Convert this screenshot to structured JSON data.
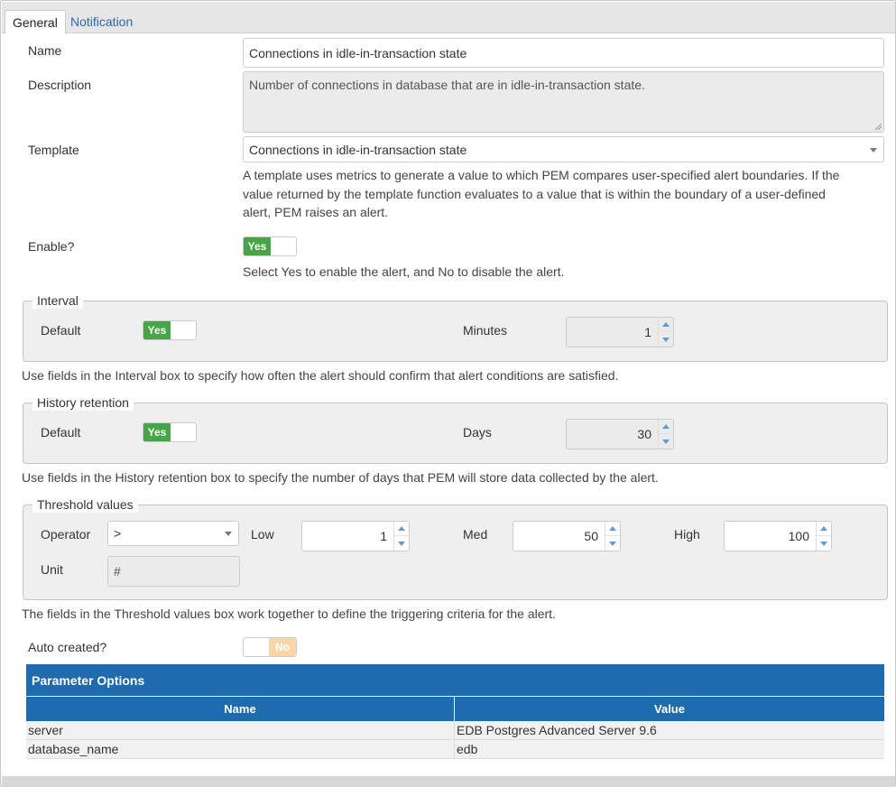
{
  "tabs": {
    "general": "General",
    "notification": "Notification"
  },
  "form": {
    "name": {
      "label": "Name",
      "value": "Connections in idle-in-transaction state"
    },
    "description": {
      "label": "Description",
      "value": "Number of connections in database that are in idle-in-transaction state."
    },
    "template": {
      "label": "Template",
      "value": "Connections in idle-in-transaction state",
      "help_lines": [
        "A template uses metrics to generate a value to which PEM compares user-specified alert boundaries. If the",
        "value returned by the template function evaluates to a value that is within the boundary of a user-defined",
        "alert, PEM raises an alert."
      ]
    },
    "enable": {
      "label": "Enable?",
      "toggle": "Yes",
      "help": "Select Yes to enable the alert, and No to disable the alert."
    }
  },
  "interval": {
    "legend": "Interval",
    "default_label": "Default",
    "default_toggle": "Yes",
    "minutes_label": "Minutes",
    "minutes_value": "1",
    "help": "Use fields in the Interval box to specify how often the alert should confirm that alert conditions are satisfied."
  },
  "history": {
    "legend": "History retention",
    "default_label": "Default",
    "default_toggle": "Yes",
    "days_label": "Days",
    "days_value": "30",
    "help": "Use fields in the History retention box to specify the number of days that PEM will store data collected by the alert."
  },
  "threshold": {
    "legend": "Threshold values",
    "operator_label": "Operator",
    "operator_value": ">",
    "low_label": "Low",
    "low_value": "1",
    "med_label": "Med",
    "med_value": "50",
    "high_label": "High",
    "high_value": "100",
    "unit_label": "Unit",
    "unit_value": "#",
    "help": "The fields in the Threshold values box work together to define the triggering criteria for the alert."
  },
  "auto_created": {
    "label": "Auto created?",
    "toggle": "No"
  },
  "parameters": {
    "title": "Parameter Options",
    "columns": [
      "Name",
      "Value"
    ],
    "rows": [
      {
        "name": "server",
        "value": "EDB Postgres Advanced Server 9.6"
      },
      {
        "name": "database_name",
        "value": "edb"
      }
    ]
  },
  "colors": {
    "toggle_on": "#47a447",
    "toggle_off": "#f7d6a8",
    "grid_header": "#1e6bad",
    "tab_link": "#2c6aa8"
  }
}
